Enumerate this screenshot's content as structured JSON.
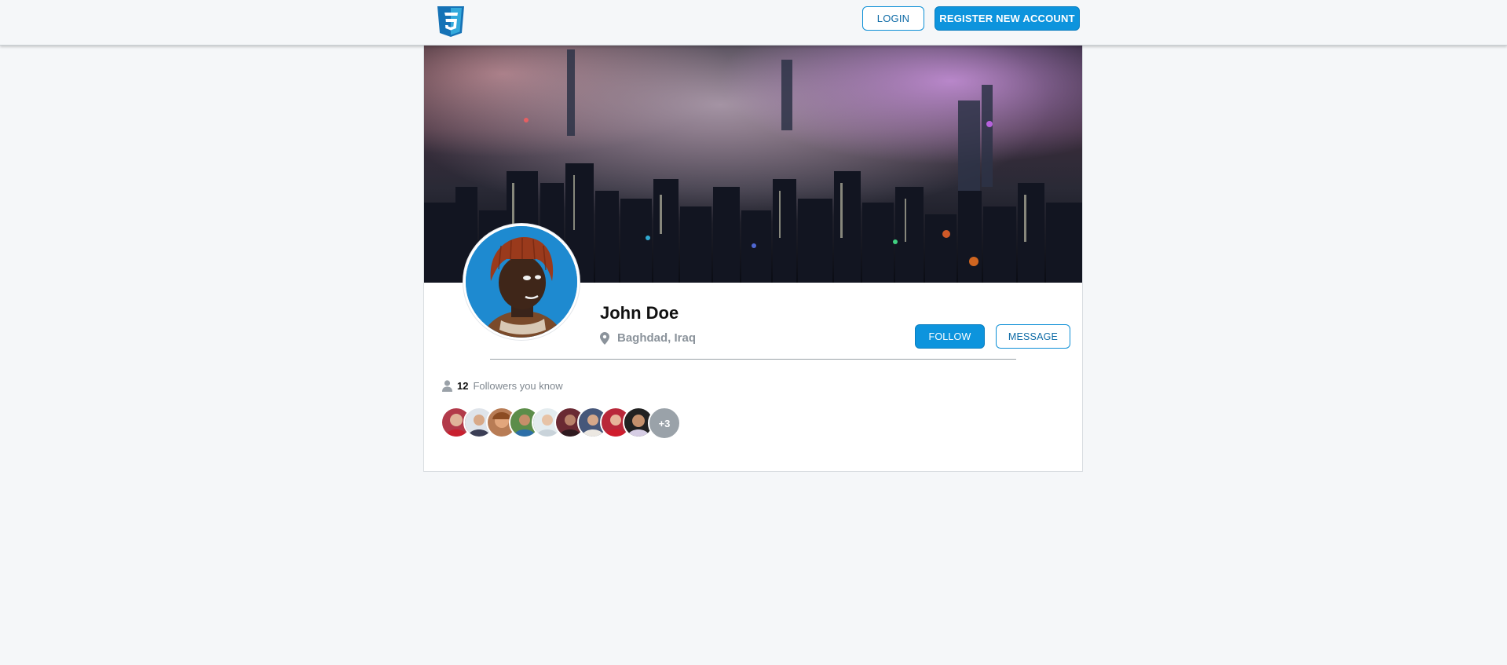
{
  "header": {
    "logo_icon": "css3-logo-icon",
    "login_label": "LOGIN",
    "register_label": "REGISTER NEW ACCOUNT"
  },
  "profile": {
    "name": "John Doe",
    "location_icon": "map-pin-icon",
    "location": "Baghdad, Iraq",
    "follow_label": "FOLLOW",
    "message_label": "MESSAGE"
  },
  "followers": {
    "icon": "user-icon",
    "count": "12",
    "label": "Followers you know",
    "more_label": "+3"
  },
  "colors": {
    "accent": "#0d94dd",
    "background": "#f5f7f9",
    "muted_text": "#8b939b"
  }
}
